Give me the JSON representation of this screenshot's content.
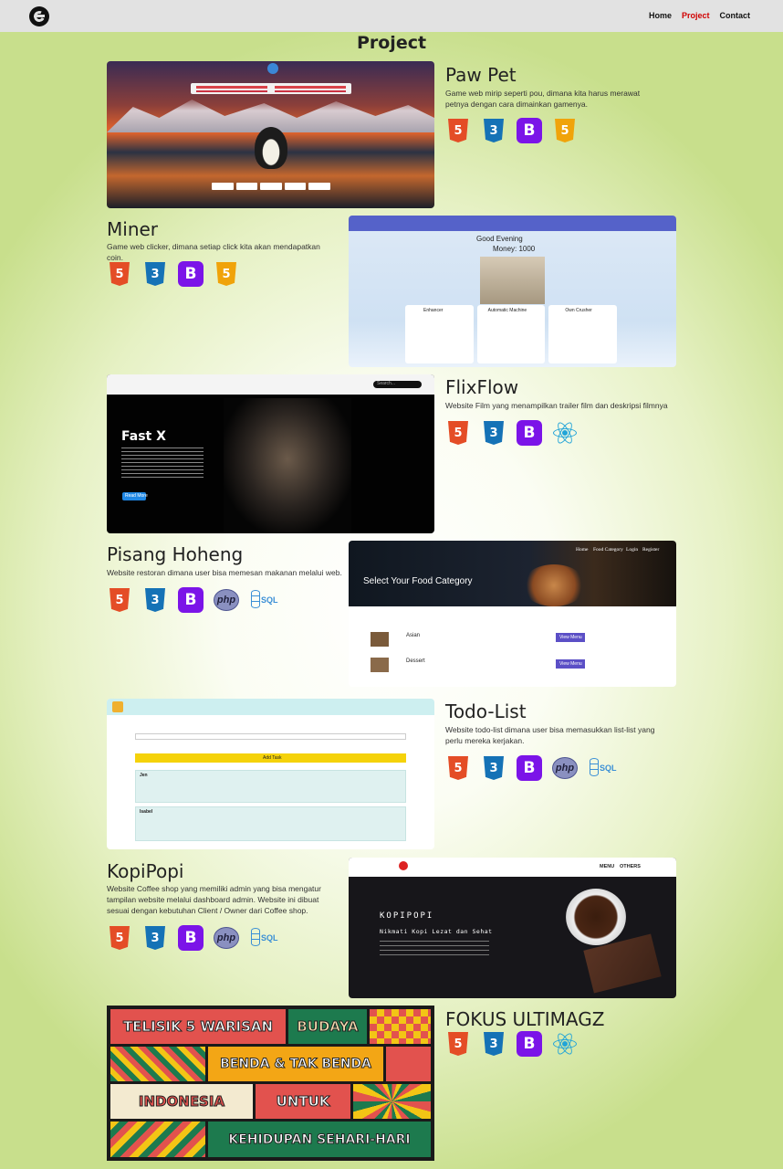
{
  "nav": {
    "links": [
      "Home",
      "Project",
      "Contact"
    ],
    "active": "Project"
  },
  "page": {
    "title": "Project"
  },
  "projects": [
    {
      "title": "Paw Pet",
      "desc": "Game web mirip seperti pou, dimana kita harus merawat petnya dengan cara dimainkan gamenya.",
      "icons": [
        "html5-icon",
        "css3-icon",
        "bootstrap-icon",
        "javascript-icon"
      ]
    },
    {
      "title": "Miner",
      "desc": "Game web clicker, dimana setiap click kita akan mendapatkan coin.",
      "icons": [
        "html5-icon",
        "css3-icon",
        "bootstrap-icon",
        "javascript-icon"
      ],
      "shot": {
        "greeting": "Good Evening",
        "money": "Money: 1000",
        "cards": [
          "Enhancer",
          "Automatic Machine",
          "Own Crusher"
        ]
      }
    },
    {
      "title": "FlixFlow",
      "desc": "Website Film yang menampilkan trailer film dan deskripsi filmnya",
      "icons": [
        "html5-icon",
        "css3-icon",
        "bootstrap-icon",
        "react-icon"
      ],
      "shot": {
        "movie": "Fast X",
        "button": "Read More",
        "search": "Search..."
      }
    },
    {
      "title": "Pisang Hoheng",
      "desc": "Website restoran dimana user bisa memesan makanan melalui web.",
      "icons": [
        "html5-icon",
        "css3-icon",
        "bootstrap-icon",
        "php-icon",
        "sql-icon"
      ],
      "shot": {
        "nav": [
          "Home",
          "Food Category",
          "Login",
          "Register"
        ],
        "heading": "Select Your Food Category",
        "items": [
          "Asian",
          "Dessert"
        ],
        "button": "View Menu"
      }
    },
    {
      "title": "Todo-List",
      "desc": "Website todo-list dimana user bisa memasukkan list-list yang perlu mereka kerjakan.",
      "icons": [
        "html5-icon",
        "css3-icon",
        "bootstrap-icon",
        "php-icon",
        "sql-icon"
      ],
      "shot": {
        "button": "Add Task",
        "tasks": [
          "Jen",
          "Isabel"
        ]
      }
    },
    {
      "title": "KopiPopi",
      "desc": "Website Coffee shop yang memiliki admin yang bisa mengatur tampilan website melalui dashboard admin. Website ini dibuat sesuai dengan kebutuhan Client / Owner dari Coffee shop.",
      "icons": [
        "html5-icon",
        "css3-icon",
        "bootstrap-icon",
        "php-icon",
        "sql-icon"
      ],
      "shot": {
        "brand": "KOPIPOPI",
        "tagline": "Nikmati Kopi Lezat dan Sehat",
        "nav": [
          "MENU",
          "OTHERS"
        ]
      }
    },
    {
      "title": "FOKUS ULTIMAGZ",
      "icons": [
        "html5-icon",
        "css3-icon",
        "bootstrap-icon",
        "react-icon"
      ],
      "shot": {
        "lines": [
          "TELISIK 5 WARISAN",
          "BUDAYA",
          "BENDA & TAK BENDA",
          "INDONESIA",
          "UNTUK",
          "KEHIDUPAN SEHARI-HARI"
        ]
      }
    }
  ],
  "icon_labels": {
    "html5": "5",
    "css3": "3",
    "js": "5",
    "bootstrap": "B",
    "php": "php",
    "sql": "SQL"
  },
  "colors": {
    "active_nav": "#d00000",
    "bootstrap": "#7b14e8",
    "html5": "#e44d26",
    "css3": "#1572b6"
  }
}
